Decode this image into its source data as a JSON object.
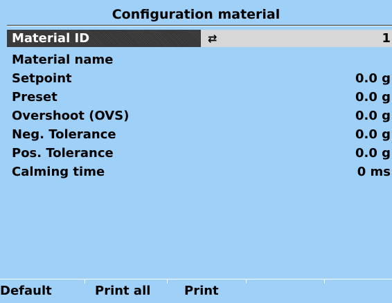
{
  "title": "Configuration material",
  "fields": [
    {
      "label": "Material ID",
      "value": "1"
    },
    {
      "label": "Material name",
      "value": ""
    },
    {
      "label": "Setpoint",
      "value": "0.0 g"
    },
    {
      "label": "Preset",
      "value": "0.0 g"
    },
    {
      "label": "Overshoot (OVS)",
      "value": "0.0 g"
    },
    {
      "label": "Neg. Tolerance",
      "value": "0.0 g"
    },
    {
      "label": "Pos. Tolerance",
      "value": "0.0 g"
    },
    {
      "label": "Calming time",
      "value": "0 ms"
    }
  ],
  "icons": {
    "selection": "swap-arrows-icon"
  },
  "softkeys": [
    {
      "label": "Default"
    },
    {
      "label": "Print all"
    },
    {
      "label": "Print"
    },
    {
      "label": ""
    },
    {
      "label": ""
    }
  ],
  "colors": {
    "background": "#9fd0f7",
    "selected_row": "#d7d7d7",
    "selected_label": "#3a3a3a"
  }
}
